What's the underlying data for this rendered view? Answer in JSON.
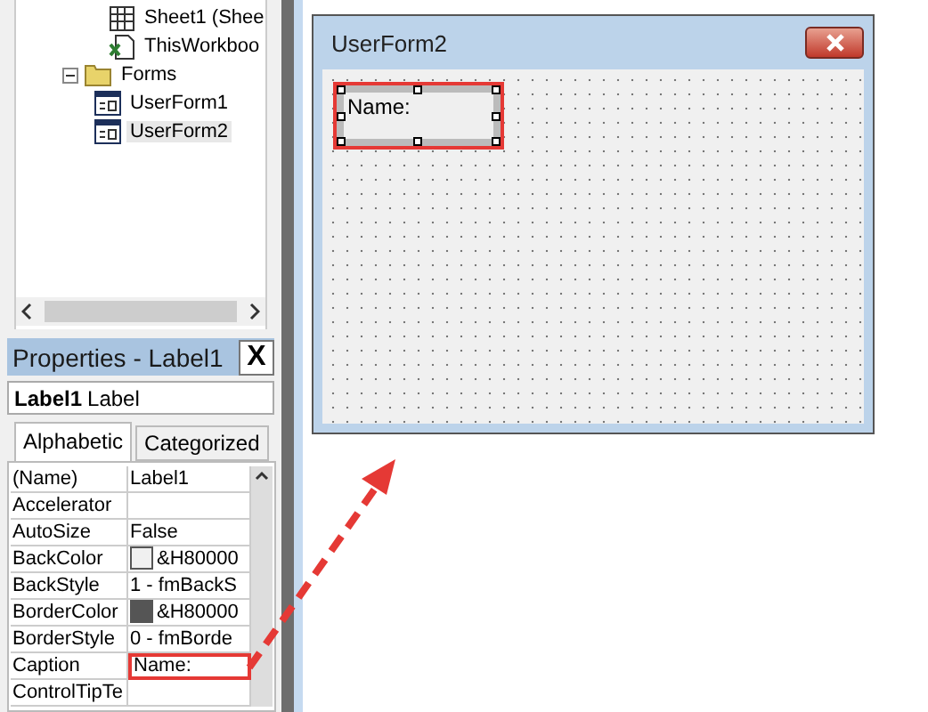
{
  "project_tree": [
    {
      "children": [
        {
          "label": "Sheet1 (Shee",
          "kind": "sheet",
          "selected": false
        },
        {
          "label": "ThisWorkboo",
          "kind": "workbook",
          "selected": false
        }
      ]
    },
    {
      "label": "Forms",
      "kind": "folder",
      "expanded": true,
      "selected": false,
      "children": [
        {
          "label": "UserForm1",
          "kind": "form",
          "selected": false
        },
        {
          "label": "UserForm2",
          "kind": "form",
          "selected": true
        }
      ]
    }
  ],
  "properties": {
    "title": "Properties - Label1",
    "close": "X",
    "object_name": "Label1",
    "object_type": "Label",
    "tabs": [
      {
        "label": "Alphabetic",
        "selected": true
      },
      {
        "label": "Categorized",
        "selected": false
      }
    ],
    "rows": [
      {
        "name": "(Name)",
        "value": "Label1",
        "highlighted": false
      },
      {
        "name": "Accelerator",
        "value": "",
        "highlighted": false
      },
      {
        "name": "AutoSize",
        "value": "False",
        "highlighted": false
      },
      {
        "name": "BackColor",
        "value": "&H80000",
        "color": "#f0f0f0",
        "highlighted": false
      },
      {
        "name": "BackStyle",
        "value": "1 - fmBackS",
        "highlighted": false
      },
      {
        "name": "BorderColor",
        "value": "&H80000",
        "color": "#555555",
        "highlighted": false
      },
      {
        "name": "BorderStyle",
        "value": "0 - fmBorde",
        "highlighted": false
      },
      {
        "name": "Caption",
        "value": "Name:",
        "highlighted": true
      },
      {
        "name": "ControlTipTe",
        "value": "",
        "highlighted": false
      }
    ]
  },
  "user_form": {
    "title": "UserForm2",
    "label": {
      "caption": "Name:",
      "selected": true,
      "highlighted": true
    }
  }
}
